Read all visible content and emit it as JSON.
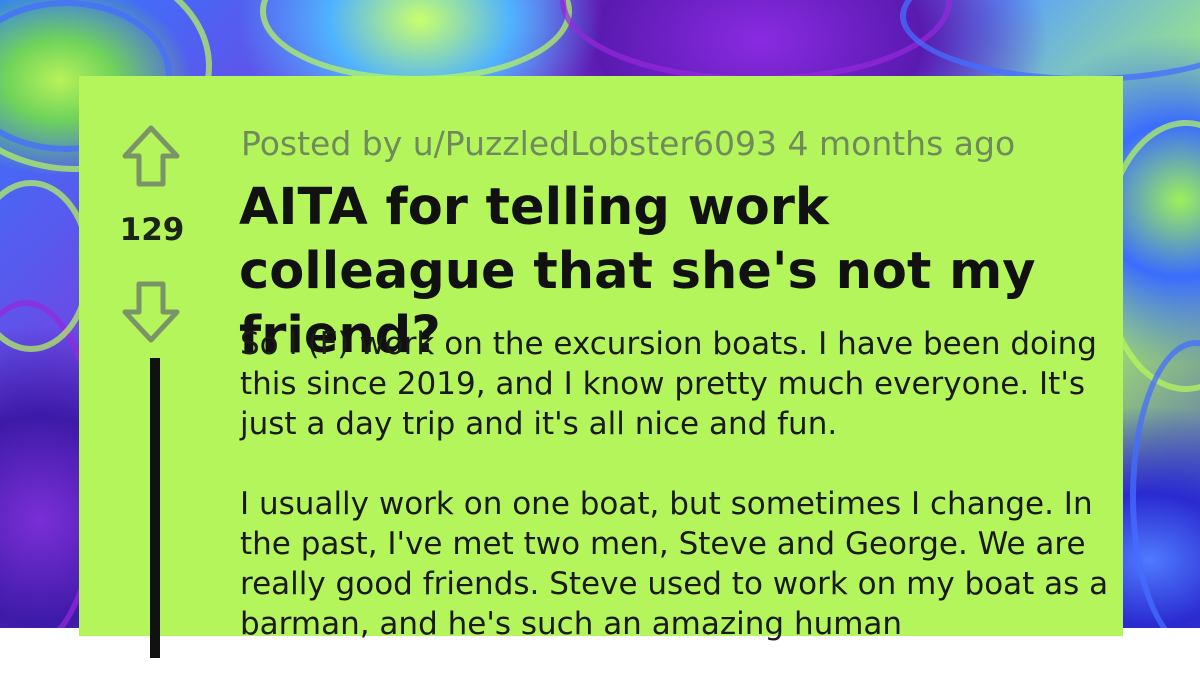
{
  "post": {
    "score": "129",
    "meta": "Posted by u/PuzzledLobster6093 4 months ago",
    "title": "AITA for telling work colleague that she's not my friend?",
    "paragraphs": [
      "So I (F) work on the excursion boats. I have been doing this since 2019, and I know pretty much everyone. It's just a day trip and it's all nice and fun.",
      "I usually work on one boat, but sometimes I change. In the past, I've met two men, Steve and George. We are really good friends. Steve used to work on my boat as a barman, and he's such an amazing human"
    ]
  },
  "icons": {
    "upvote": "arrow-up-icon",
    "downvote": "arrow-down-icon"
  },
  "colors": {
    "card_background": "#b5f55c",
    "meta_text": "#6f8a5c",
    "icon_stroke": "#7a9468"
  }
}
